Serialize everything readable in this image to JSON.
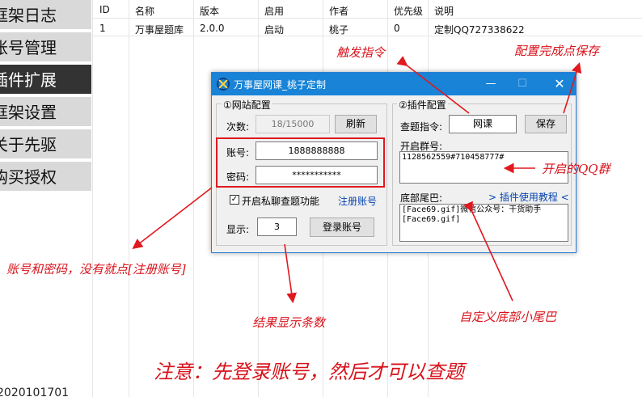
{
  "sidebar": {
    "items": [
      {
        "label": "框架日志"
      },
      {
        "label": "账号管理"
      },
      {
        "label": "插件扩展"
      },
      {
        "label": "框架设置"
      },
      {
        "label": "关于先驱"
      },
      {
        "label": "购买授权"
      }
    ],
    "version": "2020101701"
  },
  "table": {
    "headers": [
      "ID",
      "名称",
      "版本",
      "启用",
      "作者",
      "优先级",
      "说明"
    ],
    "rows": [
      [
        "1",
        "万事屋题库",
        "2.0.0",
        "启动",
        "桃子",
        "0",
        "定制QQ727338622"
      ]
    ]
  },
  "dialog": {
    "title": "万事屋网课_桃子定制",
    "left_group": "①网站配置",
    "count_label": "次数:",
    "count_value": "18/15000",
    "refresh_button": "刷新",
    "account_label": "账号:",
    "account_value": "1888888888",
    "password_label": "密码:",
    "password_value": "***********",
    "private_check_label": "开启私聊查题功能",
    "register_link": "注册账号",
    "display_label": "显示:",
    "display_value": "3",
    "login_button": "登录账号",
    "right_group": "②插件配置",
    "query_label": "查题指令:",
    "query_value": "网课",
    "save_button": "保存",
    "groups_label": "开启群号:",
    "groups_value": "1128562559#710458777#",
    "tail_label": "底部尾巴:",
    "tutorial_link": "> 插件使用教程 <",
    "tail_value": "[Face69.gif]微信公众号：干货助手\n[Face69.gif]"
  },
  "annotations": {
    "trigger": "触发指令",
    "save_done": "配置完成点保存",
    "qq_groups": "开启的QQ群",
    "account_hint": "账号和密码，没有就点[注册账号]",
    "display_count": "结果显示条数",
    "custom_tail": "自定义底部小尾巴",
    "notice": "注意：先登录账号，然后才可以查题"
  },
  "colors": {
    "annotation_red": "#d8121b",
    "titlebar_blue": "#1883d7",
    "sidebar_active": "#333333"
  }
}
